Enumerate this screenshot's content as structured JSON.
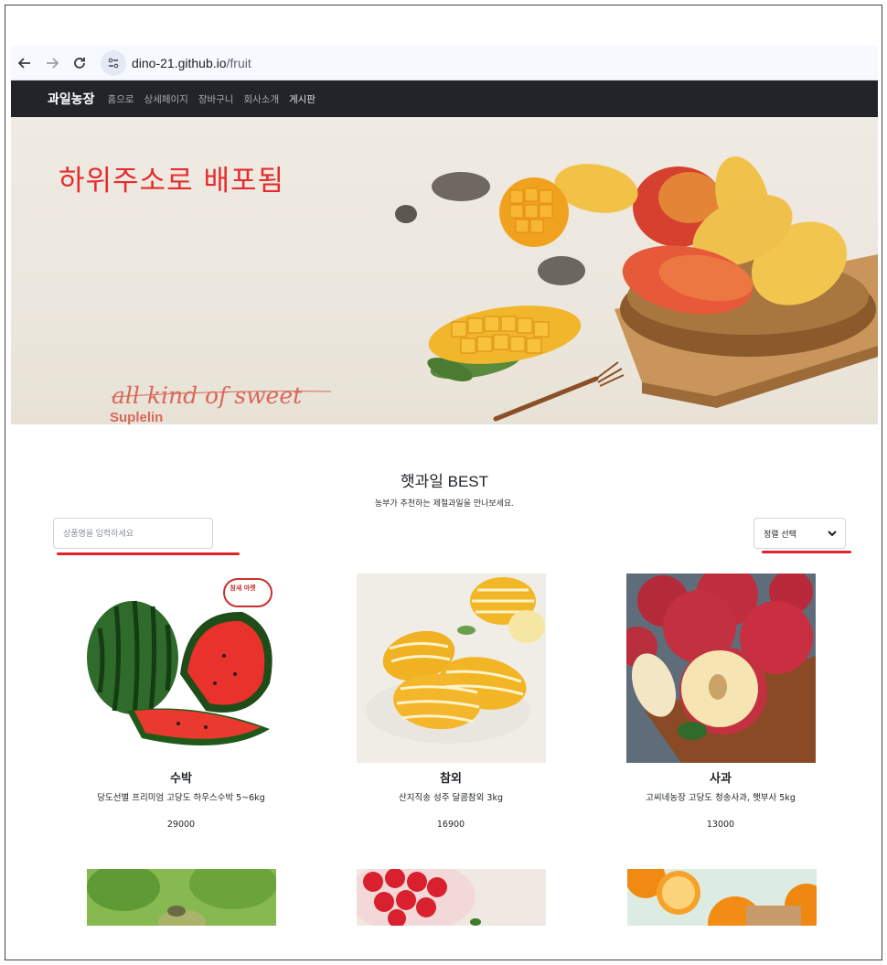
{
  "browser": {
    "domain": "dino-21.github.io",
    "path": "/fruit"
  },
  "nav": {
    "brand": "과일농장",
    "links": [
      "홈으로",
      "상세페이지",
      "장바구니",
      "회사소개",
      "게시판"
    ]
  },
  "hero": {
    "annotation": "하위주소로 배포됨",
    "script_text": "all kind of sweet",
    "brand_text": "Suplelin"
  },
  "best": {
    "title": "햇과일 BEST",
    "subtitle": "농부가 추천하는 제철과일을 만나보세요.",
    "search_placeholder": "상품명을 입력하세요",
    "sort_label": "정렬 선택"
  },
  "products": [
    {
      "name": "수박",
      "desc": "당도선별 프리미엄 고당도 하우스수박 5~6kg",
      "price": "29000",
      "badge": "참새 마켓"
    },
    {
      "name": "참외",
      "desc": "산지직송 성주 달콤참외 3kg",
      "price": "16900"
    },
    {
      "name": "사과",
      "desc": "고씨네농장 고당도 청송사과, 햇부사 5kg",
      "price": "13000"
    }
  ],
  "colors": {
    "nav_bg": "#212529",
    "annotation_red": "#e52d2d",
    "underline_red": "#e0222b"
  }
}
